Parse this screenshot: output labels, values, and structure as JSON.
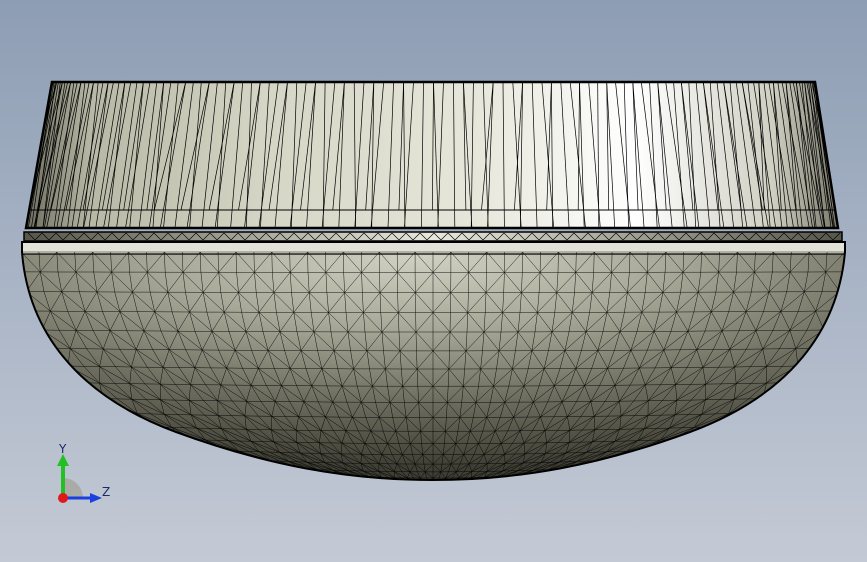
{
  "viewport": {
    "background_top": "#8d9db3",
    "background_bottom": "#c4cad5"
  },
  "model": {
    "name": "",
    "display_mode": "shaded-with-edges",
    "mesh_edge_color": "#000000",
    "rim_color_light": "#f4f4ea",
    "rim_color_dark": "#8c8c78",
    "dome_color_light": "#d8d8cc",
    "dome_color_dark": "#3a3a30"
  },
  "triad": {
    "y_label": "Y",
    "z_label": "Z",
    "y_color": "#22c022",
    "z_color": "#1a3fe0",
    "x_color": "#e01a1a"
  }
}
